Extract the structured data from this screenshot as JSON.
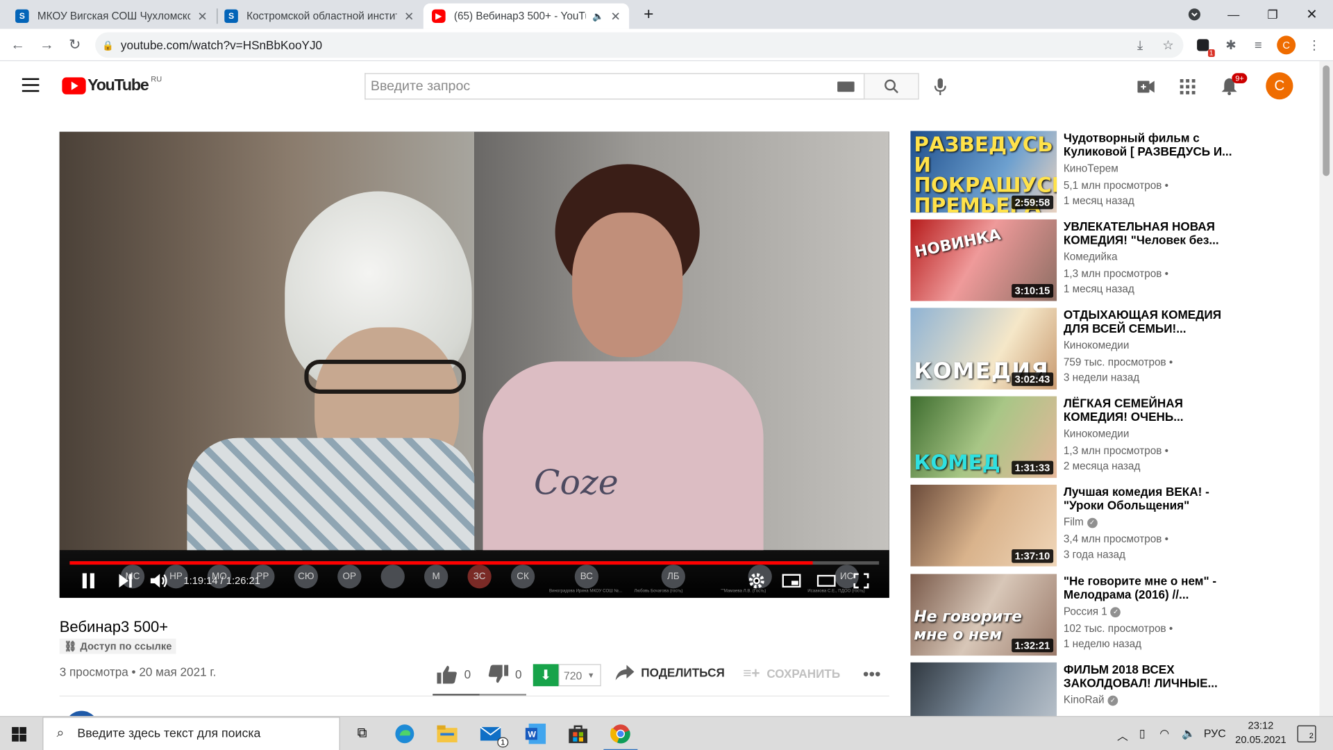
{
  "browser": {
    "tabs": [
      {
        "title": "МКОУ Вигская СОШ Чухломско",
        "favicon": "sharepoint-icon",
        "color": "#0364b8"
      },
      {
        "title": "Костромской областной инстит",
        "favicon": "sharepoint-icon",
        "color": "#0364b8"
      },
      {
        "title": "(65) Вебинар3 500+ - YouTu",
        "favicon": "youtube-icon",
        "color": "#ff0000",
        "active": true,
        "audio": "speaker-icon"
      }
    ],
    "new_tab": "+",
    "url": "youtube.com/watch?v=HSnBbKooYJ0",
    "profile_initial": "C",
    "extension_badge": "1"
  },
  "youtube": {
    "logo_text": "YouTube",
    "region": "RU",
    "search_placeholder": "Введите запрос",
    "notification_count": "9+",
    "avatar_initial": "C"
  },
  "player": {
    "time_current": "1:19:14",
    "time_total": "1:26:21",
    "progress_fraction": 0.918,
    "participants": [
      "МС",
      "НР",
      "МО",
      "РР",
      "СЮ",
      "ОР",
      "",
      "М",
      "ЗС",
      "СК",
      "ВС",
      "ЛБ",
      "",
      "ИС"
    ],
    "participant_names": [
      "Виноградова Ирина МКОУ СОШ №...",
      "Любовь Бочагова (гость)",
      "\"\"Мамаева Л.В. (Гость)",
      "Исаакова С.Е., ПДОО (гость)"
    ]
  },
  "video": {
    "title": "Вебинар3 500+",
    "access": "Доступ по ссылке",
    "views": "3 просмотра • 20 мая 2021 г.",
    "likes": "0",
    "dislikes": "0",
    "quality": "720",
    "share": "ПОДЕЛИТЬСЯ",
    "save": "СОХРАНИТЬ"
  },
  "recommendations": [
    {
      "title": "Чудотворный фильм с Куликовой [ РАЗВЕДУСЬ И...",
      "channel": "КиноТерем",
      "views": "5,1 млн просмотров •",
      "age": "1 месяц назад",
      "duration": "2:59:58",
      "thumb_text": "РАЗВЕДУСЬ И ПОКРАШУСЬ ПРЕМЬЕРА",
      "verified": false
    },
    {
      "title": "УВЛЕКАТЕЛЬНАЯ НОВАЯ КОМЕДИЯ! \"Человек без...",
      "channel": "Комедийка",
      "views": "1,3 млн просмотров •",
      "age": "1 месяц назад",
      "duration": "3:10:15",
      "thumb_text": "НОВИНКА",
      "verified": false
    },
    {
      "title": "ОТДЫХАЮЩАЯ КОМЕДИЯ ДЛЯ ВСЕЙ СЕМЬИ!...",
      "channel": "Кинокомедии",
      "views": "759 тыс. просмотров •",
      "age": "3 недели назад",
      "duration": "3:02:43",
      "thumb_text": "КОМЕДИЯ",
      "verified": false
    },
    {
      "title": "ЛЁГКАЯ СЕМЕЙНАЯ КОМЕДИЯ! ОЧЕНЬ...",
      "channel": "Кинокомедии",
      "views": "1,3 млн просмотров •",
      "age": "2 месяца назад",
      "duration": "1:31:33",
      "thumb_text": "КОМЕД",
      "verified": false
    },
    {
      "title": "Лучшая комедия ВЕКА! - \"Уроки Обольщения\" Русск...",
      "channel": "Film",
      "views": "3,4 млн просмотров •",
      "age": "3 года назад",
      "duration": "1:37:10",
      "thumb_text": "",
      "verified": true
    },
    {
      "title": "\"Не говорите мне о нем\" - Мелодрама (2016) //...",
      "channel": "Россия 1",
      "views": "102 тыс. просмотров •",
      "age": "1 неделю назад",
      "duration": "1:32:21",
      "thumb_text": "Не говорите мне о нем",
      "verified": true
    },
    {
      "title": "ФИЛЬМ 2018 ВСЕХ ЗАКОЛДОВАЛ! ЛИЧНЫЕ...",
      "channel": "KinoRaй",
      "views": "",
      "age": "",
      "duration": "",
      "thumb_text": "",
      "verified": true
    }
  ],
  "taskbar": {
    "search_placeholder": "Введите здесь текст для поиска",
    "lang": "РУС",
    "time": "23:12",
    "date": "20.05.2021",
    "mail_badge": "1",
    "notif_count": "2"
  }
}
